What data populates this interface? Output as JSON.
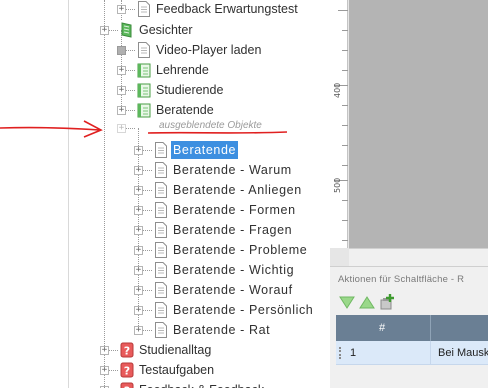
{
  "tree": {
    "rows": [
      {
        "name": "Feedback Erwartungstest",
        "icon": "page"
      },
      {
        "name": "Gesichter",
        "icon": "green-folder"
      },
      {
        "name": "Video-Player laden",
        "icon": "page"
      },
      {
        "name": "Lehrende",
        "icon": "green-book"
      },
      {
        "name": "Studierende",
        "icon": "green-book"
      },
      {
        "name": "Beratende",
        "icon": "green-book"
      },
      {
        "name": "ausgeblendete Objekte",
        "icon": "none"
      },
      {
        "name": "Beratende",
        "icon": "page"
      },
      {
        "name": "Beratende - Warum",
        "icon": "page"
      },
      {
        "name": "Beratende - Anliegen",
        "icon": "page"
      },
      {
        "name": "Beratende - Formen",
        "icon": "page"
      },
      {
        "name": "Beratende - Fragen",
        "icon": "page"
      },
      {
        "name": "Beratende - Probleme",
        "icon": "page"
      },
      {
        "name": "Beratende - Wichtig",
        "icon": "page"
      },
      {
        "name": "Beratende - Worauf",
        "icon": "page"
      },
      {
        "name": "Beratende - Persönlich",
        "icon": "page"
      },
      {
        "name": "Beratende - Rat",
        "icon": "page"
      },
      {
        "name": "Studienalltag",
        "icon": "red-question"
      },
      {
        "name": "Testaufgaben",
        "icon": "red-question"
      },
      {
        "name": "Feedback & Feedback",
        "icon": "red-question"
      }
    ]
  },
  "ruler": {
    "labels": [
      "400",
      "500"
    ]
  },
  "actions": {
    "title": "Aktionen für Schaltfläche - R",
    "toolbar": [
      {
        "icon": "move-down-icon",
        "color": "#9ad88a"
      },
      {
        "icon": "move-up-icon",
        "color": "#9ad88a"
      },
      {
        "icon": "add-action-icon",
        "color": "#6db35c"
      }
    ],
    "columns": [
      "#",
      ""
    ],
    "rows": [
      {
        "number": "1",
        "trigger": "Bei Mausk"
      }
    ]
  },
  "colors": {
    "selection": "#3d8fe0",
    "grid_header": "#6a7f94",
    "grid_row": "#dbe9f9",
    "annotation": "#e02020"
  }
}
